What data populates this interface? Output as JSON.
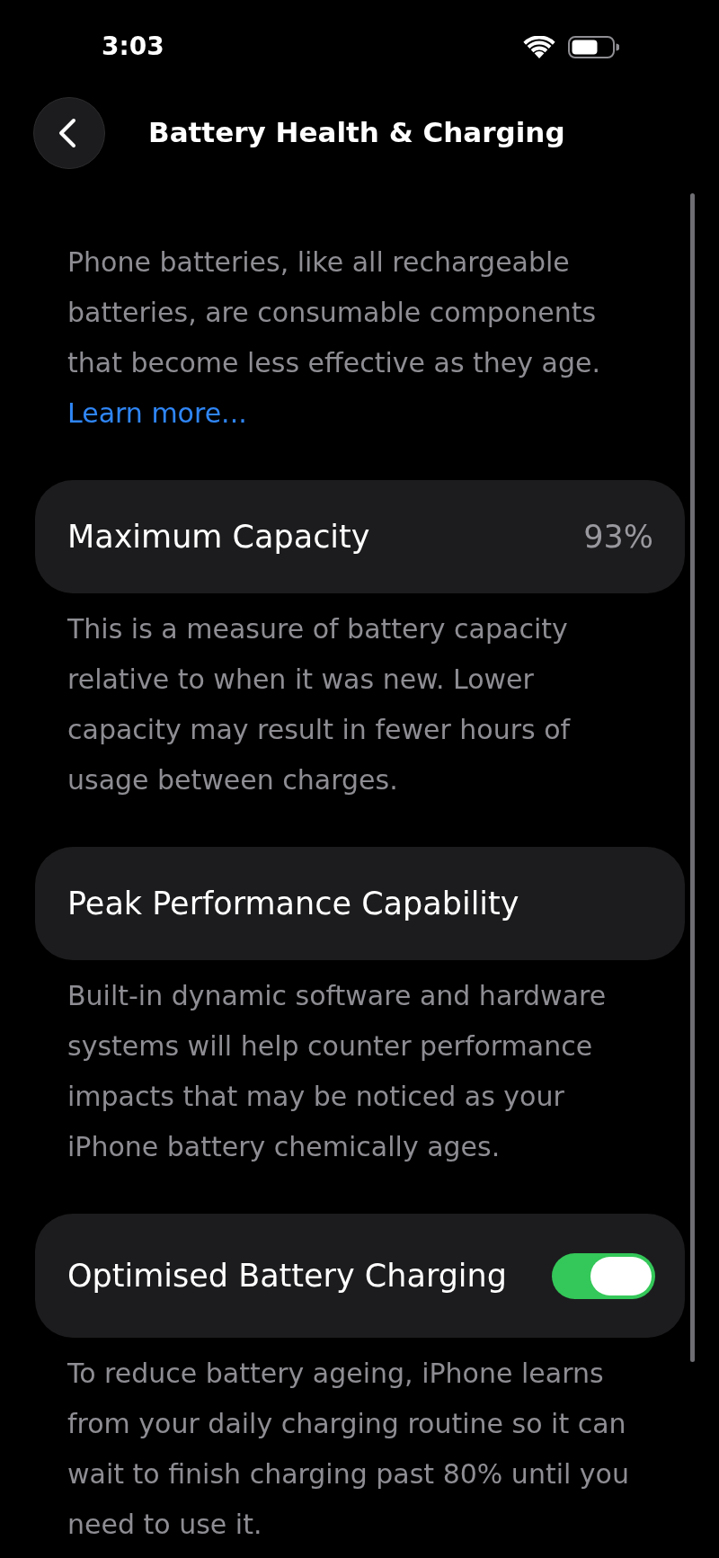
{
  "status_bar": {
    "time": "3:03"
  },
  "nav": {
    "title": "Battery Health & Charging"
  },
  "intro": {
    "text": "Phone batteries, like all rechargeable batteries, are consumable components that become less effective as they age.",
    "link": "Learn more..."
  },
  "sections": [
    {
      "kind": "value",
      "label": "Maximum Capacity",
      "value": "93%",
      "description": "This is a measure of battery capacity relative to when it was new. Lower capacity may result in fewer hours of usage between charges."
    },
    {
      "kind": "plain",
      "label": "Peak Performance Capability",
      "description": "Built-in dynamic software and hardware systems will help counter performance impacts that may be noticed as your iPhone battery chemically ages."
    },
    {
      "kind": "toggle",
      "label": "Optimised Battery Charging",
      "on": true,
      "description": "To reduce battery ageing, iPhone learns from your daily charging routine so it can wait to finish charging past 80% until you need to use it."
    }
  ]
}
